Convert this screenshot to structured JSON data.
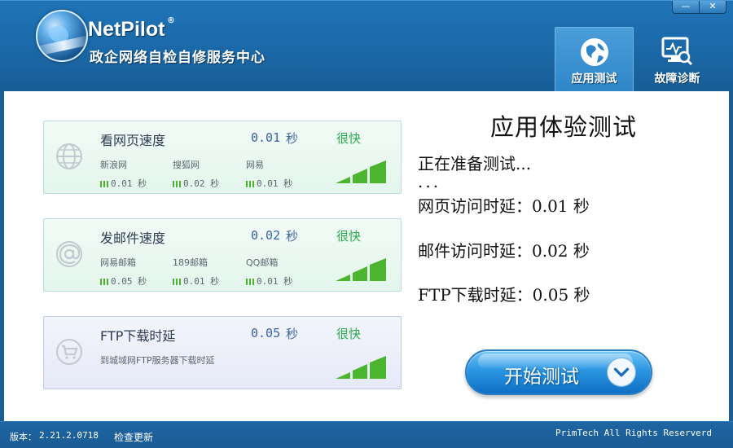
{
  "app": {
    "brand_name": "NetPilot",
    "brand_mark": "®",
    "subtitle": "政企网络自检自修服务中心"
  },
  "window_controls": {
    "minimize": "—",
    "close": "✕"
  },
  "tabs": [
    {
      "label": "应用测试",
      "icon": "globe-icon",
      "active": true
    },
    {
      "label": "故障诊断",
      "icon": "diagnosis-monitor-icon",
      "active": false
    }
  ],
  "cards": [
    {
      "title": "看网页速度",
      "icon": "globe-icon",
      "value": "0.01",
      "unit": "秒",
      "rating": "很快",
      "signal_level": 3,
      "signal_max": 3,
      "subs": [
        {
          "name": "新浪网",
          "value": "0.01",
          "unit": "秒"
        },
        {
          "name": "搜狐网",
          "value": "0.02",
          "unit": "秒"
        },
        {
          "name": "网易",
          "value": "0.01",
          "unit": "秒"
        }
      ]
    },
    {
      "title": "发邮件速度",
      "icon": "at-sign-icon",
      "value": "0.02",
      "unit": "秒",
      "rating": "很快",
      "signal_level": 3,
      "signal_max": 3,
      "subs": [
        {
          "name": "网易邮箱",
          "value": "0.05",
          "unit": "秒"
        },
        {
          "name": "189邮箱",
          "value": "0.01",
          "unit": "秒"
        },
        {
          "name": "QQ邮箱",
          "value": "0.01",
          "unit": "秒"
        }
      ]
    },
    {
      "title": "FTP下载时延",
      "icon": "cart-icon",
      "value": "0.05",
      "unit": "秒",
      "rating": "很快",
      "signal_level": 3,
      "signal_max": 3,
      "description": "到城域网FTP服务器下载时延"
    }
  ],
  "result_panel": {
    "title": "应用体验测试",
    "lines": [
      "正在准备测试...",
      "...",
      "网页访问时延：0.01 秒",
      "邮件访问时延：0.02 秒",
      "FTP下载时延：0.05 秒"
    ]
  },
  "start_button": {
    "label": "开始测试",
    "icon": "chevron-down-icon"
  },
  "footer": {
    "version_label": "版本：",
    "version": "2.21.2.0718",
    "update_link": "检查更新",
    "copyright": "PrimTech All Rights Reserverd"
  },
  "colors": {
    "header_blue": "#1b68a7",
    "accent_value": "#3b62a8",
    "rating_green": "#2bab4e",
    "signal_green": "#4cb530"
  }
}
